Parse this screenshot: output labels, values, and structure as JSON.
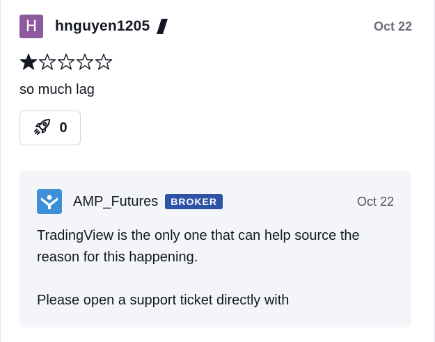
{
  "review": {
    "avatar_letter": "H",
    "username": "hnguyen1205",
    "date": "Oct 22",
    "rating": 1,
    "max_rating": 5,
    "text": "so much lag",
    "boost_count": "0"
  },
  "reply": {
    "author": "AMP_Futures",
    "badge": "BROKER",
    "date": "Oct 22",
    "paragraphs": [
      "TradingView is the only one that can help source the reason for this happening.",
      "Please open a support ticket directly with"
    ]
  },
  "colors": {
    "avatar_bg": "#8e5a9e",
    "broker_logo_bg": "#3d8fd7",
    "badge_bg": "#2e53a6",
    "reply_bg": "#f3f5f9"
  },
  "icons": {
    "author_mark": "pen-icon",
    "boost": "rocket-icon",
    "broker_logo": "amp-logo-icon"
  }
}
